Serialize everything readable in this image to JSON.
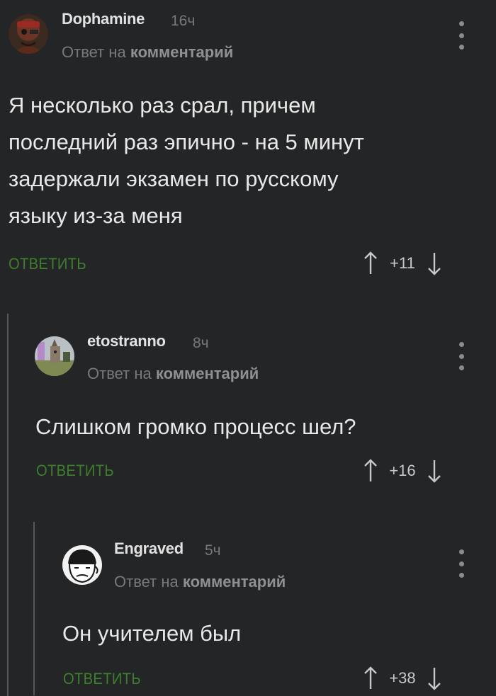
{
  "comments": [
    {
      "author": "Dophamine",
      "time": "16ч",
      "reply_prefix": "Ответ на",
      "reply_link": "комментарий",
      "text": "Я несколько раз срал, причем\nпоследний раз эпично - на 5 минут\nзадержали экзамен по русскому\nязыку из-за меня",
      "reply_label": "ОТВЕТИТЬ",
      "rating": "+11",
      "avatar_icon": "avatar-dophamine"
    },
    {
      "author": "etostranno",
      "time": "8ч",
      "reply_prefix": "Ответ на",
      "reply_link": "комментарий",
      "text": "Слишком громко процесс шел?",
      "reply_label": "ОТВЕТИТЬ",
      "rating": "+16",
      "avatar_icon": "avatar-etostranno"
    },
    {
      "author": "Engraved",
      "time": "5ч",
      "reply_prefix": "Ответ на",
      "reply_link": "комментарий",
      "text": "Он учителем был",
      "reply_label": "ОТВЕТИТЬ",
      "rating": "+38",
      "avatar_icon": "avatar-engraved"
    }
  ],
  "colors": {
    "background": "#242527",
    "reply_green": "#3e7f2e",
    "muted": "#77797c",
    "thread_line": "#555759"
  }
}
